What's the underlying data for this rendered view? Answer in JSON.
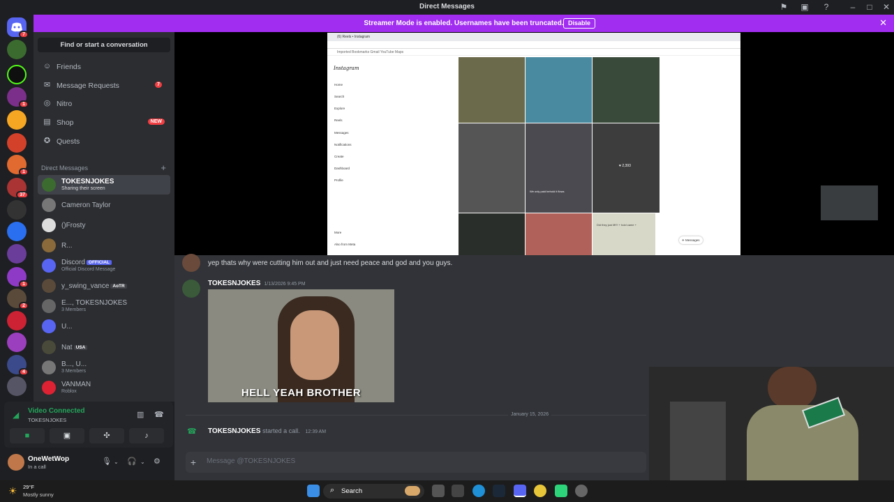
{
  "window": {
    "title": "Direct Messages",
    "icons": [
      "inbox-icon",
      "screen-icon",
      "help-icon",
      "minimize-icon",
      "maximize-icon",
      "close-icon"
    ]
  },
  "banner": {
    "text": "Streamer Mode is enabled. Usernames have been truncated.",
    "button": "Disable"
  },
  "servers": {
    "badges": [
      "7",
      "1",
      "1",
      "37",
      "1",
      "2",
      "4"
    ]
  },
  "sidebar": {
    "find": "Find or start a conversation",
    "nav": [
      {
        "label": "Friends",
        "icon": "friends-icon"
      },
      {
        "label": "Message Requests",
        "badge": "7",
        "icon": "mail-icon"
      },
      {
        "label": "Nitro",
        "icon": "nitro-icon"
      },
      {
        "label": "Shop",
        "badge": "NEW",
        "icon": "shop-icon"
      },
      {
        "label": "Quests",
        "icon": "quests-icon"
      }
    ],
    "dm_header": "Direct Messages",
    "dms": [
      {
        "name": "TOKESNJOKES",
        "sub": "Sharing their screen"
      },
      {
        "name": "Cameron Taylor"
      },
      {
        "name": "()Frosty"
      },
      {
        "name": "R..."
      },
      {
        "name": "Discord",
        "tag": "OFFICIAL",
        "sub": "Official Discord Message"
      },
      {
        "name": "y_swing_vance",
        "tag": "AoTR"
      },
      {
        "name": "E..., TOKESNJOKES",
        "sub": "3 Members"
      },
      {
        "name": "U..."
      },
      {
        "name": "Nat",
        "tag": "USA"
      },
      {
        "name": "B..., U...",
        "sub": "3 Members"
      },
      {
        "name": "VANMAN",
        "sub": "Roblox"
      }
    ]
  },
  "voice": {
    "status": "Video Connected",
    "channel": "TOKESNJOKES"
  },
  "user": {
    "name": "OneWetWop",
    "status": "In a call"
  },
  "stream": {
    "tab_title": "(6) Reels • Instagram",
    "bookmarks": "Imported Bookmarks   Gmail   YouTube   Maps",
    "logo": "Instagram",
    "nav": [
      "Home",
      "Search",
      "Explore",
      "Reels",
      "Messages",
      "Notifications",
      "Create",
      "Dashboard",
      "Profile"
    ],
    "nav_bottom": [
      "More",
      "Also from Meta"
    ],
    "tile_text_1": "We only paid behold it flows",
    "tile_text_2": "Did they just lift?! + hold came +",
    "messages_label": "Messages",
    "likes": "2,393"
  },
  "chat": {
    "first_message": "yep thats why were cutting him out and just need peace and god and you guys.",
    "author": "TOKESNJOKES",
    "timestamp": "1/13/2026 9:45 PM",
    "gif_caption": "HELL YEAH BROTHER",
    "date_divider": "January 15, 2026",
    "call_author": "TOKESNJOKES",
    "call_text": "started a call.",
    "call_time": "12:39 AM",
    "input_placeholder": "Message @TOKESNJOKES"
  },
  "taskbar": {
    "temp": "29°F",
    "weather": "Mostly sunny",
    "search": "Search"
  }
}
